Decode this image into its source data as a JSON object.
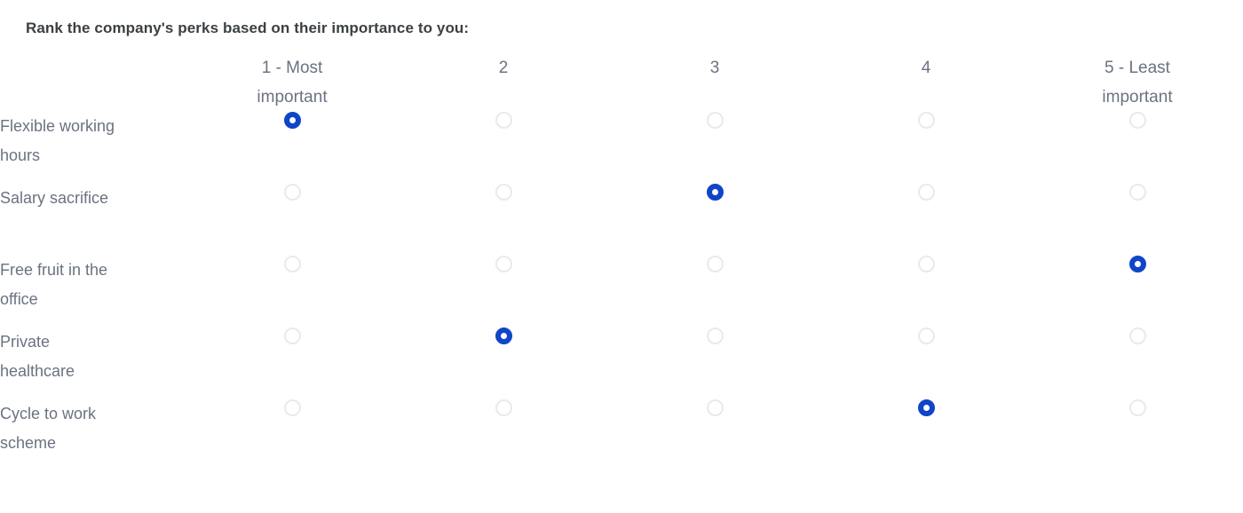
{
  "question": {
    "title": "Rank the company's perks based on their importance to you:"
  },
  "matrix": {
    "columns": [
      {
        "label": "1 - Most important",
        "value": 1
      },
      {
        "label": "2",
        "value": 2
      },
      {
        "label": "3",
        "value": 3
      },
      {
        "label": "4",
        "value": 4
      },
      {
        "label": "5 - Least important",
        "value": 5
      }
    ],
    "rows": [
      {
        "label": "Flexible working hours",
        "selected": 1
      },
      {
        "label": "Salary sacrifice",
        "selected": 3
      },
      {
        "label": "Free fruit in the office",
        "selected": 5
      },
      {
        "label": "Private healthcare",
        "selected": 2
      },
      {
        "label": "Cycle to work scheme",
        "selected": 4
      }
    ]
  },
  "colors": {
    "selected_radio": "#1045c8",
    "unselected_radio_border": "#e8eaed",
    "label_text": "#6b7280",
    "title_text": "#3c4043",
    "background": "#ffffff"
  }
}
